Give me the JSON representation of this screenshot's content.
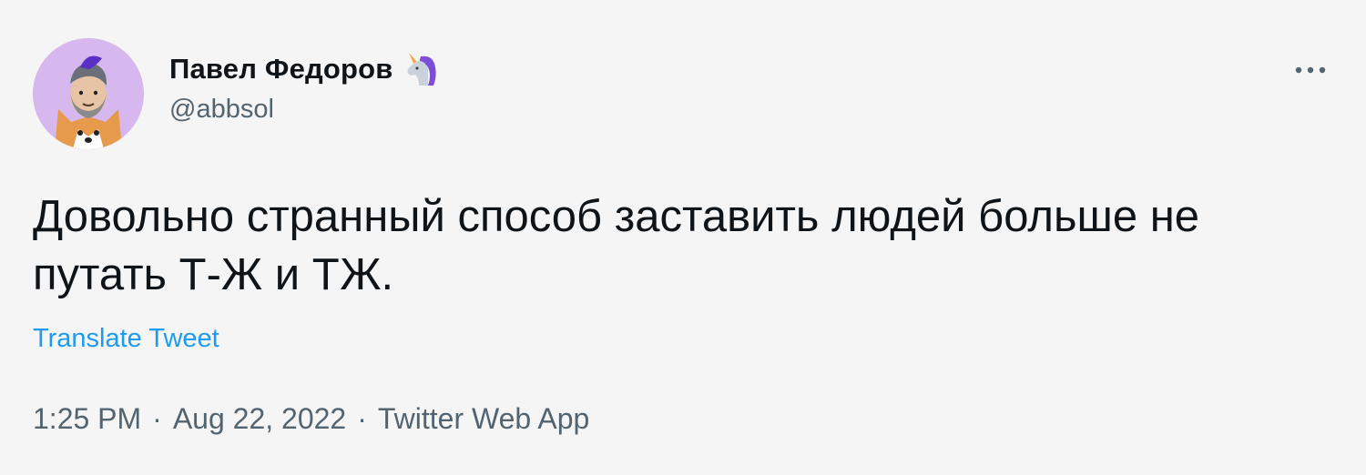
{
  "author": {
    "display_name": "Павел Федоров",
    "handle": "@abbsol",
    "badge_icon": "unicorn-icon",
    "avatar_bg": "#d7b8ee"
  },
  "menu": {
    "icon": "more-options-icon"
  },
  "tweet": {
    "text": "Довольно странный способ заставить людей больше не путать Т-Ж и ТЖ.",
    "translate_label": "Translate Tweet"
  },
  "meta": {
    "time": "1:25 PM",
    "separator": "·",
    "date": "Aug 22, 2022",
    "source": "Twitter Web App"
  },
  "colors": {
    "background": "#f5f5f5",
    "text": "#0f1419",
    "secondary": "#536471",
    "link": "#1d9bf0"
  }
}
